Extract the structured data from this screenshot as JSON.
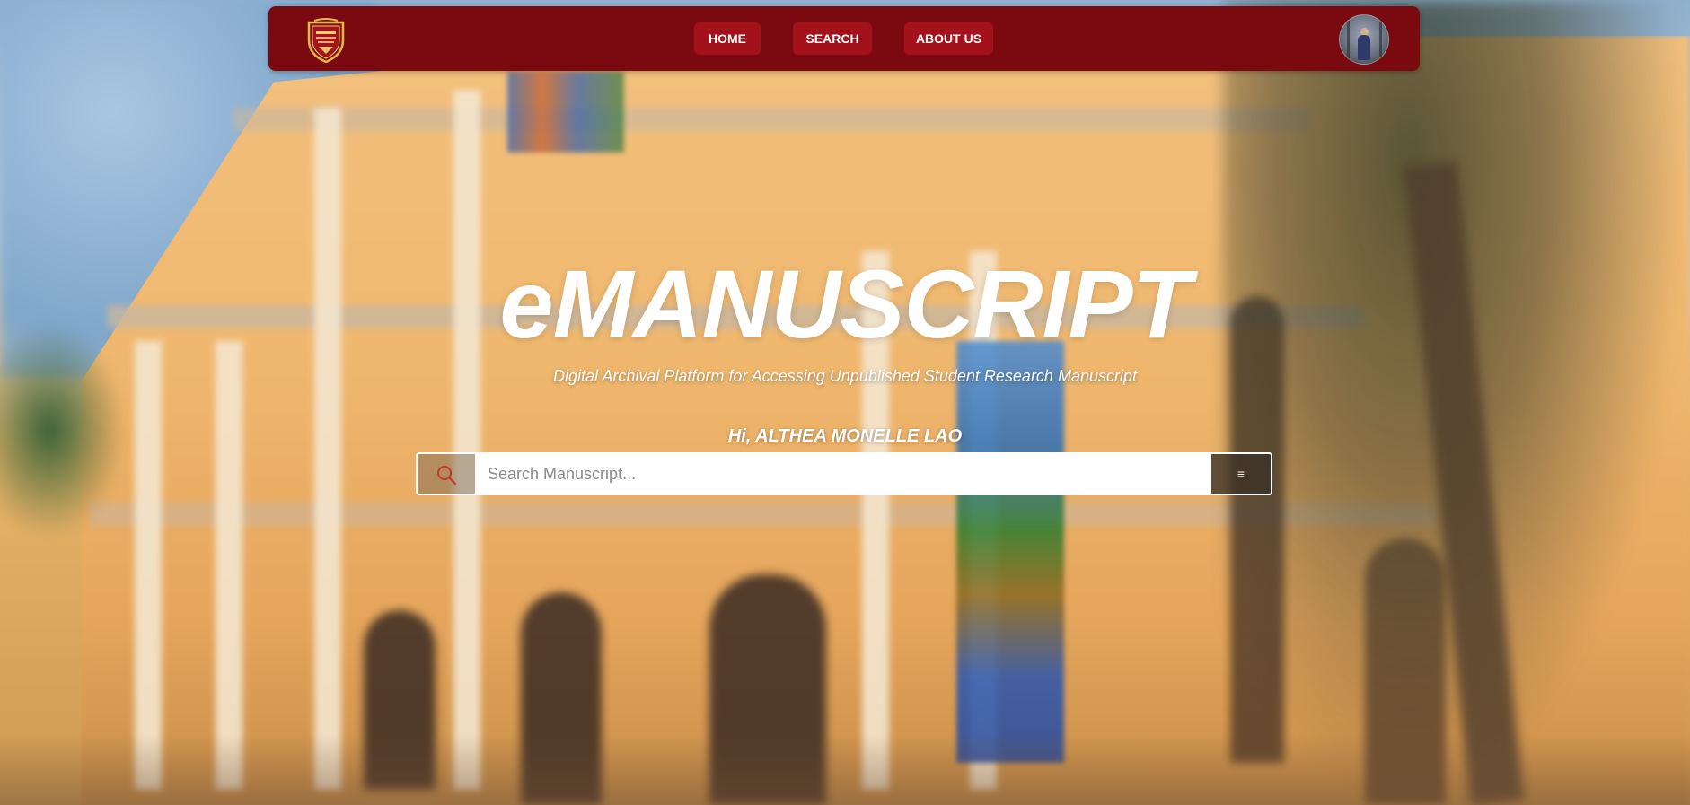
{
  "navbar": {
    "logo_icon": "university-crest-logo",
    "items": [
      {
        "label": "HOME"
      },
      {
        "label": "SEARCH"
      },
      {
        "label": "ABOUT US"
      }
    ],
    "avatar_icon": "user-avatar"
  },
  "hero": {
    "title": "eMANUSCRIPT",
    "subtitle": "Digital Archival Platform for Accessing Unpublished Student Research Manuscript",
    "greeting": "Hi, ALTHEA MONELLE LAO"
  },
  "search": {
    "placeholder": "Search Manuscript...",
    "value": "",
    "search_icon": "search-icon",
    "filter_glyph": "≡",
    "filter_icon": "filter-menu-icon"
  },
  "colors": {
    "navbar_bg": "#7a0a10",
    "nav_button_bg": "#a3111a",
    "text_light": "#ffffff",
    "search_icon_color": "#c0392b"
  }
}
